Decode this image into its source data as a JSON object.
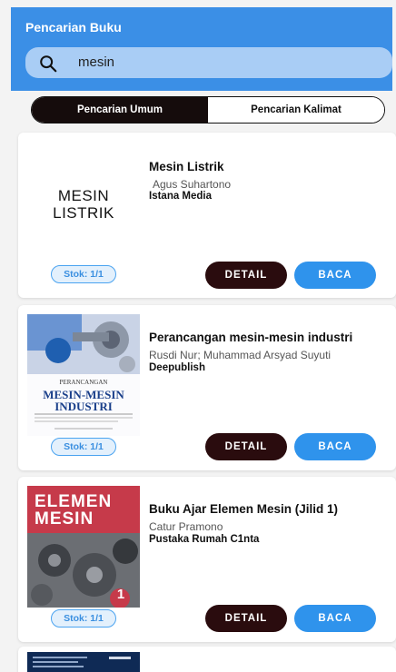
{
  "header": {
    "title": "Pencarian Buku"
  },
  "search": {
    "value": "mesin"
  },
  "tabs": [
    {
      "label": "Pencarian Umum",
      "active": true
    },
    {
      "label": "Pencarian Kalimat",
      "active": false
    }
  ],
  "buttons": {
    "detail": "DETAIL",
    "read": "BACA"
  },
  "books": [
    {
      "title": "Mesin Listrik",
      "author": "Agus Suhartono",
      "publisher": "Istana Media",
      "stock": "Stok: 1/1",
      "cover_text": "MESIN\nLISTRIK"
    },
    {
      "title": "Perancangan mesin-mesin industri",
      "author": "Rusdi Nur; Muhammad Arsyad Suyuti",
      "publisher": "Deepublish",
      "stock": "Stok: 1/1",
      "cover_text": "PERANCANGAN\nMESIN-MESIN\nINDUSTRI"
    },
    {
      "title": "Buku Ajar Elemen Mesin (Jilid 1)",
      "author": "Catur Pramono",
      "publisher": "Pustaka Rumah C1nta",
      "stock": "Stok: 1/1",
      "cover_text": "ELEMEN\nMESIN"
    }
  ],
  "colors": {
    "header": "#3b8fe6",
    "search_bg": "#a9cdf5",
    "tab_active": "#150c0c",
    "detail_btn": "#2a0c0e",
    "read_btn": "#2f93ec"
  }
}
